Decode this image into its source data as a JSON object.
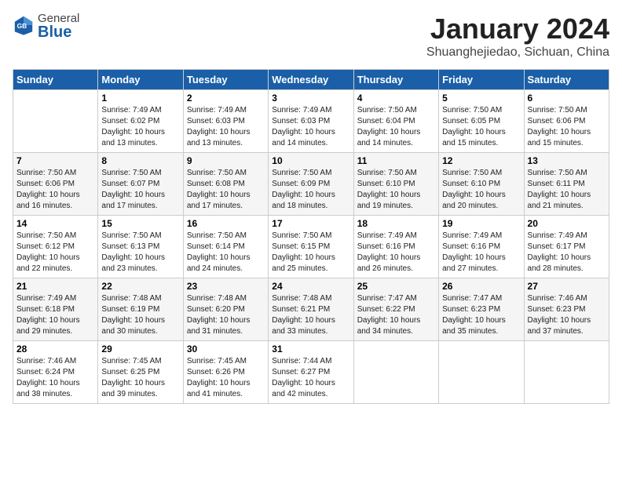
{
  "logo": {
    "line1": "General",
    "line2": "Blue"
  },
  "header": {
    "month_year": "January 2024",
    "location": "Shuanghejiedao, Sichuan, China"
  },
  "weekdays": [
    "Sunday",
    "Monday",
    "Tuesday",
    "Wednesday",
    "Thursday",
    "Friday",
    "Saturday"
  ],
  "weeks": [
    [
      {
        "day": "",
        "info": ""
      },
      {
        "day": "1",
        "info": "Sunrise: 7:49 AM\nSunset: 6:02 PM\nDaylight: 10 hours\nand 13 minutes."
      },
      {
        "day": "2",
        "info": "Sunrise: 7:49 AM\nSunset: 6:03 PM\nDaylight: 10 hours\nand 13 minutes."
      },
      {
        "day": "3",
        "info": "Sunrise: 7:49 AM\nSunset: 6:03 PM\nDaylight: 10 hours\nand 14 minutes."
      },
      {
        "day": "4",
        "info": "Sunrise: 7:50 AM\nSunset: 6:04 PM\nDaylight: 10 hours\nand 14 minutes."
      },
      {
        "day": "5",
        "info": "Sunrise: 7:50 AM\nSunset: 6:05 PM\nDaylight: 10 hours\nand 15 minutes."
      },
      {
        "day": "6",
        "info": "Sunrise: 7:50 AM\nSunset: 6:06 PM\nDaylight: 10 hours\nand 15 minutes."
      }
    ],
    [
      {
        "day": "7",
        "info": "Sunrise: 7:50 AM\nSunset: 6:06 PM\nDaylight: 10 hours\nand 16 minutes."
      },
      {
        "day": "8",
        "info": "Sunrise: 7:50 AM\nSunset: 6:07 PM\nDaylight: 10 hours\nand 17 minutes."
      },
      {
        "day": "9",
        "info": "Sunrise: 7:50 AM\nSunset: 6:08 PM\nDaylight: 10 hours\nand 17 minutes."
      },
      {
        "day": "10",
        "info": "Sunrise: 7:50 AM\nSunset: 6:09 PM\nDaylight: 10 hours\nand 18 minutes."
      },
      {
        "day": "11",
        "info": "Sunrise: 7:50 AM\nSunset: 6:10 PM\nDaylight: 10 hours\nand 19 minutes."
      },
      {
        "day": "12",
        "info": "Sunrise: 7:50 AM\nSunset: 6:10 PM\nDaylight: 10 hours\nand 20 minutes."
      },
      {
        "day": "13",
        "info": "Sunrise: 7:50 AM\nSunset: 6:11 PM\nDaylight: 10 hours\nand 21 minutes."
      }
    ],
    [
      {
        "day": "14",
        "info": "Sunrise: 7:50 AM\nSunset: 6:12 PM\nDaylight: 10 hours\nand 22 minutes."
      },
      {
        "day": "15",
        "info": "Sunrise: 7:50 AM\nSunset: 6:13 PM\nDaylight: 10 hours\nand 23 minutes."
      },
      {
        "day": "16",
        "info": "Sunrise: 7:50 AM\nSunset: 6:14 PM\nDaylight: 10 hours\nand 24 minutes."
      },
      {
        "day": "17",
        "info": "Sunrise: 7:50 AM\nSunset: 6:15 PM\nDaylight: 10 hours\nand 25 minutes."
      },
      {
        "day": "18",
        "info": "Sunrise: 7:49 AM\nSunset: 6:16 PM\nDaylight: 10 hours\nand 26 minutes."
      },
      {
        "day": "19",
        "info": "Sunrise: 7:49 AM\nSunset: 6:16 PM\nDaylight: 10 hours\nand 27 minutes."
      },
      {
        "day": "20",
        "info": "Sunrise: 7:49 AM\nSunset: 6:17 PM\nDaylight: 10 hours\nand 28 minutes."
      }
    ],
    [
      {
        "day": "21",
        "info": "Sunrise: 7:49 AM\nSunset: 6:18 PM\nDaylight: 10 hours\nand 29 minutes."
      },
      {
        "day": "22",
        "info": "Sunrise: 7:48 AM\nSunset: 6:19 PM\nDaylight: 10 hours\nand 30 minutes."
      },
      {
        "day": "23",
        "info": "Sunrise: 7:48 AM\nSunset: 6:20 PM\nDaylight: 10 hours\nand 31 minutes."
      },
      {
        "day": "24",
        "info": "Sunrise: 7:48 AM\nSunset: 6:21 PM\nDaylight: 10 hours\nand 33 minutes."
      },
      {
        "day": "25",
        "info": "Sunrise: 7:47 AM\nSunset: 6:22 PM\nDaylight: 10 hours\nand 34 minutes."
      },
      {
        "day": "26",
        "info": "Sunrise: 7:47 AM\nSunset: 6:23 PM\nDaylight: 10 hours\nand 35 minutes."
      },
      {
        "day": "27",
        "info": "Sunrise: 7:46 AM\nSunset: 6:23 PM\nDaylight: 10 hours\nand 37 minutes."
      }
    ],
    [
      {
        "day": "28",
        "info": "Sunrise: 7:46 AM\nSunset: 6:24 PM\nDaylight: 10 hours\nand 38 minutes."
      },
      {
        "day": "29",
        "info": "Sunrise: 7:45 AM\nSunset: 6:25 PM\nDaylight: 10 hours\nand 39 minutes."
      },
      {
        "day": "30",
        "info": "Sunrise: 7:45 AM\nSunset: 6:26 PM\nDaylight: 10 hours\nand 41 minutes."
      },
      {
        "day": "31",
        "info": "Sunrise: 7:44 AM\nSunset: 6:27 PM\nDaylight: 10 hours\nand 42 minutes."
      },
      {
        "day": "",
        "info": ""
      },
      {
        "day": "",
        "info": ""
      },
      {
        "day": "",
        "info": ""
      }
    ]
  ]
}
